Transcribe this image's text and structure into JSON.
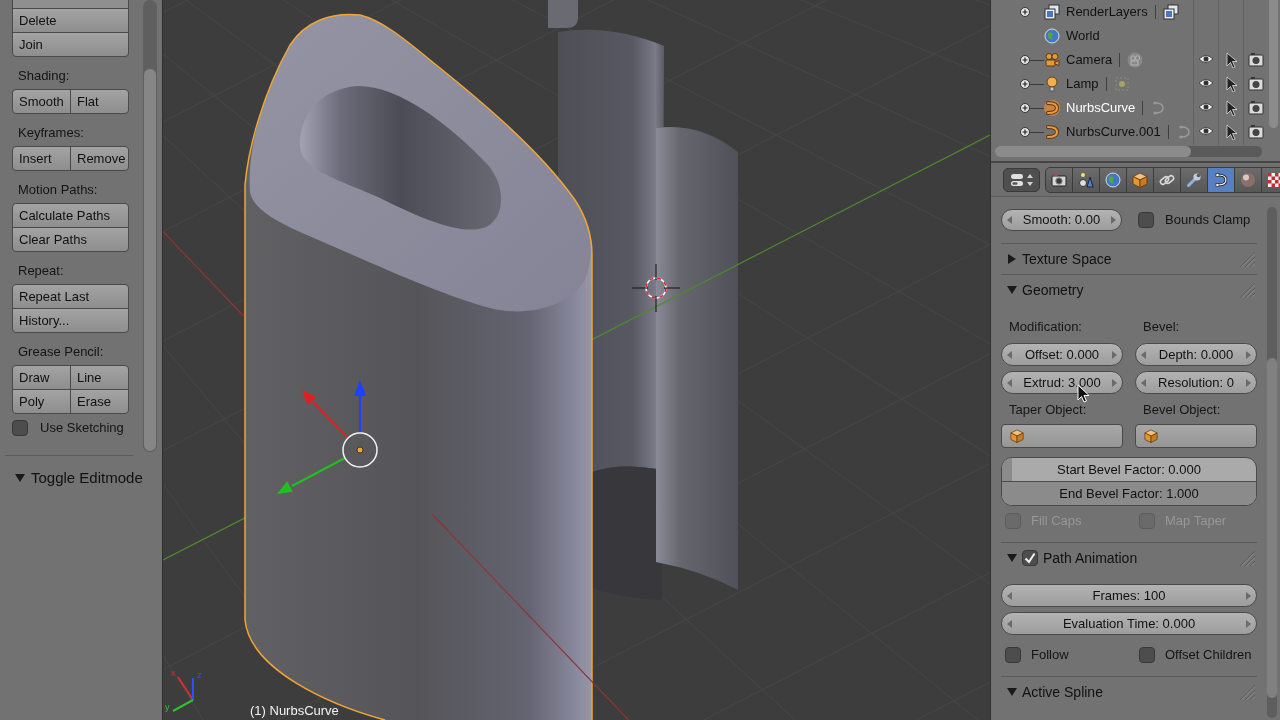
{
  "tool_shelf": {
    "groups": [
      {
        "rows": [
          [
            "Delete"
          ],
          [
            "Join"
          ]
        ]
      },
      {
        "heading": "Shading:",
        "rows": [
          [
            "Smooth",
            "Flat"
          ]
        ]
      },
      {
        "heading": "Keyframes:",
        "rows": [
          [
            "Insert",
            "Remove"
          ]
        ]
      },
      {
        "heading": "Motion Paths:",
        "rows": [
          [
            "Calculate Paths"
          ],
          [
            "Clear Paths"
          ]
        ]
      },
      {
        "heading": "Repeat:",
        "rows": [
          [
            "Repeat Last"
          ],
          [
            "History..."
          ]
        ]
      },
      {
        "heading": "Grease Pencil:",
        "rows": [
          [
            "Draw",
            "Line"
          ],
          [
            "Poly",
            "Erase"
          ]
        ]
      }
    ],
    "checkbox": {
      "label": "Use Sketching",
      "checked": false
    },
    "panel": {
      "title": "Toggle Editmode",
      "expanded": true
    }
  },
  "viewport": {
    "axis_labels": [
      {
        "kind": "x",
        "label": "x"
      },
      {
        "kind": "z",
        "label": "z"
      },
      {
        "kind": "y",
        "label": "y"
      }
    ],
    "object_label": "(1) NurbsCurve"
  },
  "outliner": {
    "items": [
      {
        "name": "RenderLayers",
        "kind": "renderlayers",
        "expanded": false,
        "selected": false
      },
      {
        "name": "World",
        "kind": "world",
        "selected": false
      },
      {
        "name": "Camera",
        "kind": "camera",
        "expanded": false,
        "selected": false
      },
      {
        "name": "Lamp",
        "kind": "lamp",
        "expanded": false,
        "selected": false
      },
      {
        "name": "NurbsCurve",
        "kind": "curve",
        "expanded": false,
        "selected": true
      },
      {
        "name": "NurbsCurve.001",
        "kind": "curve",
        "expanded": false,
        "selected": false
      }
    ]
  },
  "properties": {
    "tabs": [
      {
        "kind": "render",
        "selected": false
      },
      {
        "kind": "scene",
        "selected": false
      },
      {
        "kind": "world",
        "selected": false
      },
      {
        "kind": "object",
        "selected": false
      },
      {
        "kind": "constraints",
        "selected": false
      },
      {
        "kind": "modifiers",
        "selected": false
      },
      {
        "kind": "data",
        "selected": true
      },
      {
        "kind": "material",
        "selected": false
      },
      {
        "kind": "texture",
        "selected": false
      }
    ],
    "top_row": {
      "field": "Smooth: 0.00",
      "checkbox": {
        "label": "Bounds Clamp",
        "checked": false
      }
    },
    "panels": [
      {
        "title": "Texture Space",
        "expanded": false
      },
      {
        "title": "Geometry",
        "expanded": true,
        "rows": [
          {
            "kind": "number_columns",
            "columns": [
              {
                "label": "Modification:",
                "fields": [
                  "Offset: 0.000",
                  "Extrud: 3.000"
                ]
              },
              {
                "label": "Bevel:",
                "fields": [
                  "Depth: 0.000",
                  "Resolution: 0"
                ]
              }
            ]
          },
          {
            "kind": "object_fields",
            "columns": [
              {
                "label": "Taper Object:"
              },
              {
                "label": "Bevel Object:"
              }
            ]
          },
          {
            "kind": "sliders",
            "items": [
              {
                "label": "Start Bevel Factor: 0.000",
                "level": 0
              },
              {
                "label": "End Bevel Factor: 1.000",
                "level": 1
              }
            ]
          },
          {
            "kind": "checks",
            "items": [
              {
                "label": "Fill Caps",
                "checked": false,
                "disabled": true
              },
              {
                "label": "Map Taper",
                "checked": false,
                "disabled": true
              }
            ]
          }
        ]
      },
      {
        "title": "Path Animation",
        "expanded": true,
        "checked": true,
        "rows": [
          {
            "kind": "numbers",
            "items": [
              "Frames: 100",
              "Evaluation Time: 0.000"
            ]
          },
          {
            "kind": "checks",
            "items": [
              {
                "label": "Follow",
                "checked": false,
                "disabled": false
              },
              {
                "label": "Offset Children",
                "checked": false,
                "disabled": false
              }
            ]
          }
        ]
      },
      {
        "title": "Active Spline",
        "expanded": true
      }
    ]
  }
}
